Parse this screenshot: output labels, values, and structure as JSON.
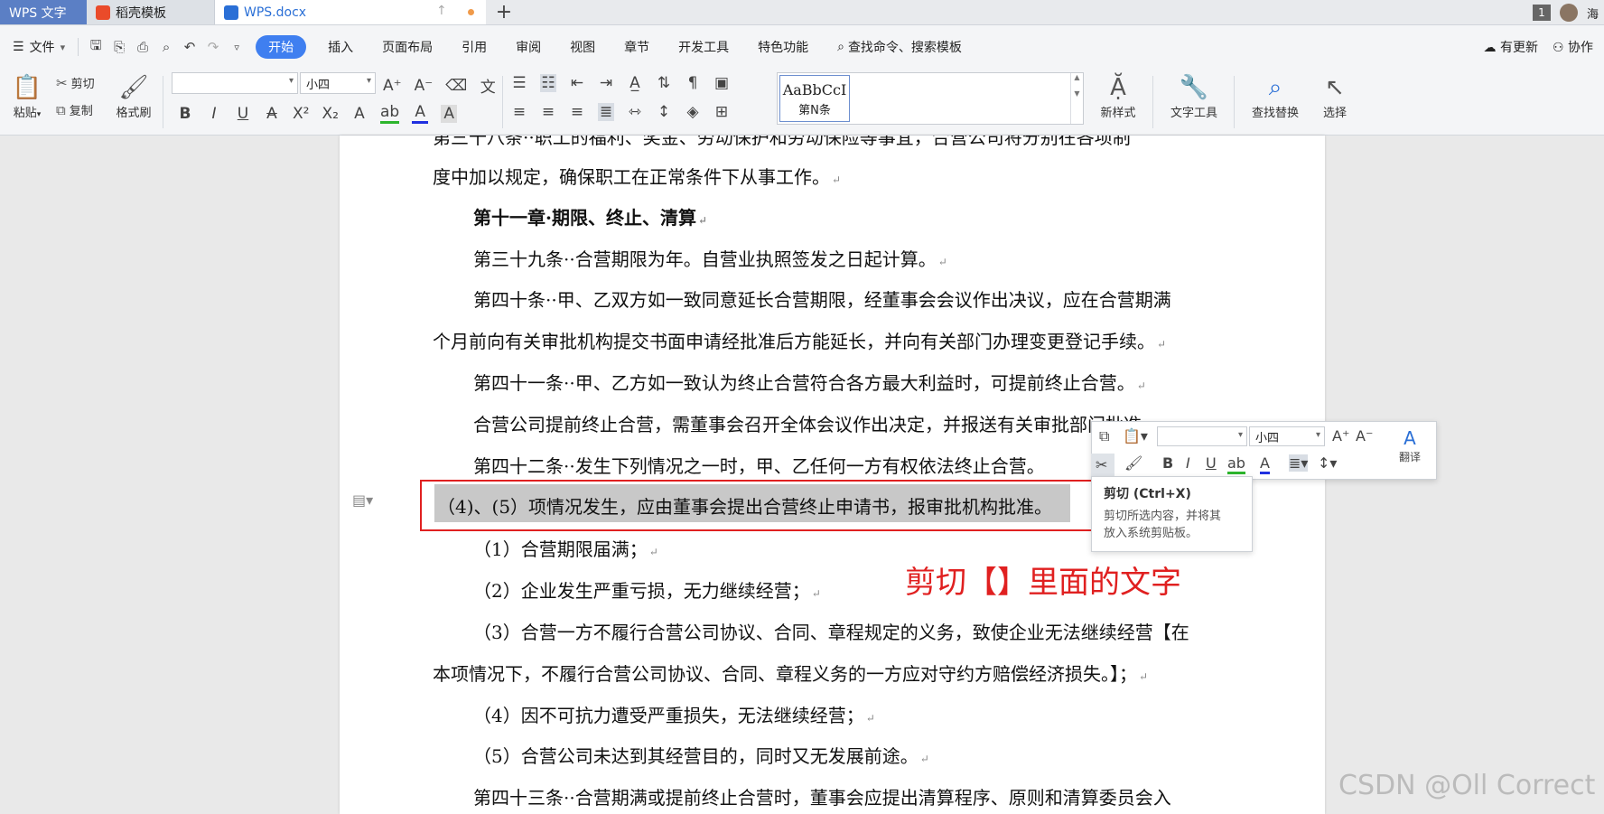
{
  "titlebar": {
    "app_tab": "WPS 文字",
    "template_tab": "稻壳模板",
    "doc_tab": "WPS.docx",
    "new_tab": "+",
    "window_count": "1",
    "user_name": "海"
  },
  "menubar": {
    "file": "文件",
    "tabs": [
      "开始",
      "插入",
      "页面布局",
      "引用",
      "审阅",
      "视图",
      "章节",
      "开发工具",
      "特色功能"
    ],
    "search": "查找命令、搜索模板",
    "update": "有更新",
    "collab": "协作"
  },
  "ribbon": {
    "paste": "粘贴",
    "cut": "剪切",
    "copy": "复制",
    "format_painter": "格式刷",
    "font_name": "",
    "font_size": "小四",
    "style_preview": "AaBbCcI",
    "style_name": "第N条",
    "new_style": "新样式",
    "text_tools": "文字工具",
    "find_replace": "查找替换",
    "select": "选择"
  },
  "document": {
    "line0": "第三十八条··职工的福利、奖金、劳动保护和劳动保险等事宜，合营公司将分别在各项制",
    "line1": "度中加以规定，确保职工在正常条件下从事工作。",
    "line2": "第十一章·期限、终止、清算",
    "line3": "第三十九条··合营期限为年。自营业执照签发之日起计算。",
    "line4": "第四十条··甲、乙双方如一致同意延长合营期限，经董事会会议作出决议，应在合营期满",
    "line5": "个月前向有关审批机构提交书面申请经批准后方能延长，并向有关部门办理变更登记手续。",
    "line6": "第四十一条··甲、乙方如一致认为终止合营符合各方最大利益时，可提前终止合营。",
    "line7": "合营公司提前终止合营，需董事会召开全体会议作出决定，并报送有关审批部门批准。",
    "line8": "第四十二条··发生下列情况之一时，甲、乙任何一方有权依法终止合营。",
    "line9": "（4)、(5）项情况发生，应由董事会提出合营终止申请书，报审批机构批准。",
    "line10": "（1）合营期限届满；",
    "line11": "（2）企业发生严重亏损，无力继续经营；",
    "line12": "（3）合营一方不履行合营公司协议、合同、章程规定的义务，致使企业无法继续经营【在",
    "line13": "本项情况下，不履行合营公司协议、合同、章程义务的一方应对守约方赔偿经济损失。】；",
    "line14": "（4）因不可抗力遭受严重损失，无法继续经营；",
    "line15": "（5）合营公司未达到其经营目的，同时又无发展前途。",
    "line16": "第四十三条··合营期满或提前终止合营时，董事会应提出清算程序、原则和清算委员会入"
  },
  "annotation": "剪切【】里面的文字",
  "mini_toolbar": {
    "font_size": "小四",
    "translate": "翻译"
  },
  "tooltip": {
    "title": "剪切 (Ctrl+X)",
    "body_line1": "剪切所选内容，并将其",
    "body_line2": "放入系统剪贴板。"
  },
  "watermark": "CSDN @Oll Correct",
  "colors": {
    "accent": "#3f7ff0",
    "annotation_red": "#e02020",
    "selection_gray": "#c8c8c8"
  }
}
